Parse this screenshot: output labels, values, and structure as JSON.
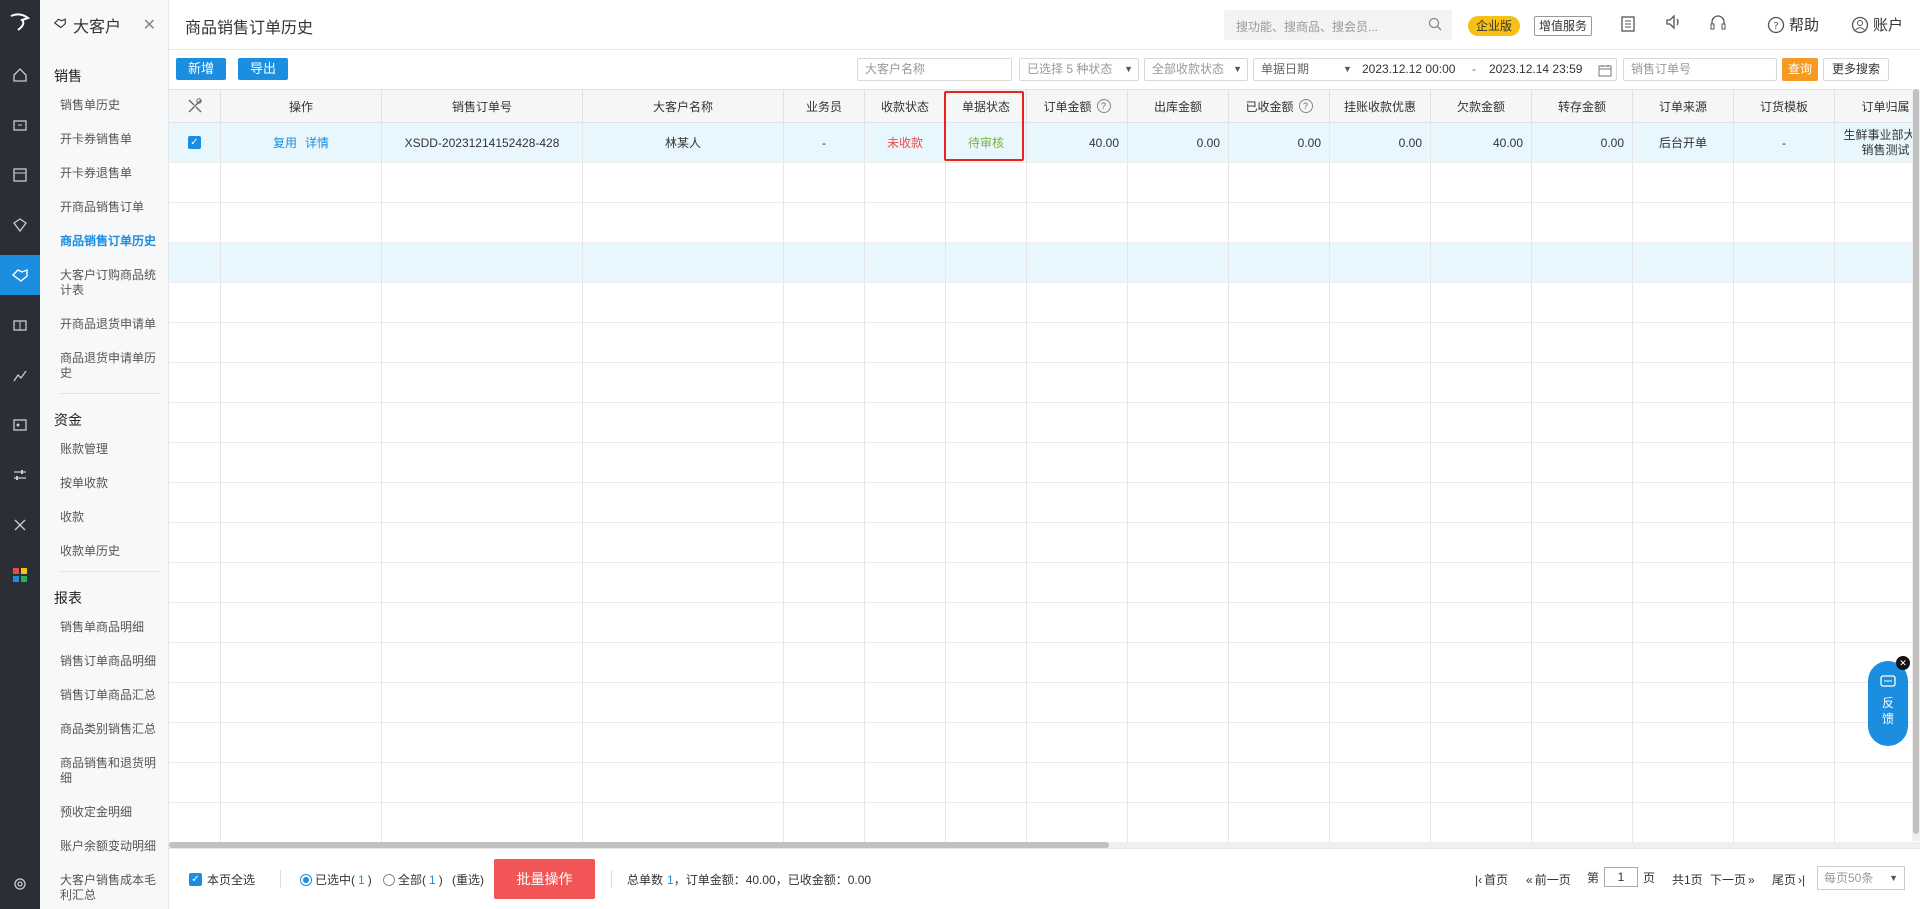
{
  "sidebar": {
    "module_title": "大客户",
    "sections": [
      {
        "title": "销售",
        "items": [
          "销售单历史",
          "开卡券销售单",
          "开卡券退售单",
          "开商品销售订单",
          "商品销售订单历史",
          "大客户订购商品统计表",
          "开商品退货申请单",
          "商品退货申请单历史"
        ]
      },
      {
        "title": "资金",
        "items": [
          "账款管理",
          "按单收款",
          "收款",
          "收款单历史"
        ]
      },
      {
        "title": "报表",
        "items": [
          "销售单商品明细",
          "销售订单商品明细",
          "销售订单商品汇总",
          "商品类别销售汇总",
          "商品销售和退货明细",
          "预收定金明细",
          "账户余额变动明细",
          "大客户销售成本毛利汇总"
        ]
      }
    ],
    "active_item": "商品销售订单历史"
  },
  "header": {
    "page_title": "商品销售订单历史",
    "search_placeholder": "搜功能、搜商品、搜会员...",
    "edition_badge": "企业版",
    "vas_label": "增值服务",
    "help_label": "帮助",
    "account_label": "账户"
  },
  "toolbar": {
    "add_label": "新增",
    "export_label": "导出",
    "customer_placeholder": "大客户名称",
    "status_filter": "已选择 5 种状态",
    "payment_filter": "全部收款状态",
    "date_type": "单据日期",
    "date_start": "2023.12.12 00:00",
    "date_sep": "-",
    "date_end": "2023.12.14 23:59",
    "order_no_placeholder": "销售订单号",
    "query_label": "查询",
    "more_label": "更多搜索"
  },
  "table": {
    "headers": [
      "操作",
      "销售订单号",
      "大客户名称",
      "业务员",
      "收款状态",
      "单据状态",
      "订单金额",
      "出库金额",
      "已收金额",
      "挂账收款优惠",
      "欠款金额",
      "转存金额",
      "订单来源",
      "订货模板",
      "订单归属"
    ],
    "row": {
      "action_reuse": "复用",
      "action_detail": "详情",
      "order_no": "XSDD-20231214152428-428",
      "customer": "林某人",
      "salesperson": "-",
      "payment_status": "未收款",
      "doc_status": "待审核",
      "order_amount": "40.00",
      "outbound_amount": "0.00",
      "received_amount": "0.00",
      "credit_discount": "0.00",
      "arrears": "40.00",
      "transfer_amount": "0.00",
      "source": "后台开单",
      "template": "-",
      "owner_line1": "生鲜事业部大客",
      "owner_line2": "销售测试"
    }
  },
  "footer": {
    "select_page": "本页全选",
    "selected_label": "已选中(",
    "selected_count": "1",
    "all_label": "全部(",
    "all_count": "1",
    "close_paren": ")",
    "reselect": "(重选)",
    "batch_label": "批量操作",
    "summary_prefix": "总单数",
    "summary_count": "1",
    "summary_rest": "，订单金额：40.00，已收金额：0.00",
    "first_page": "首页",
    "prev_page": "前一页",
    "page_pre": "第",
    "page_value": "1",
    "page_post": "页",
    "total_pages": "共1页",
    "next_page": "下一页",
    "last_page": "尾页",
    "page_size": "每页50条"
  },
  "feedback": {
    "line1": "反",
    "line2": "馈"
  }
}
